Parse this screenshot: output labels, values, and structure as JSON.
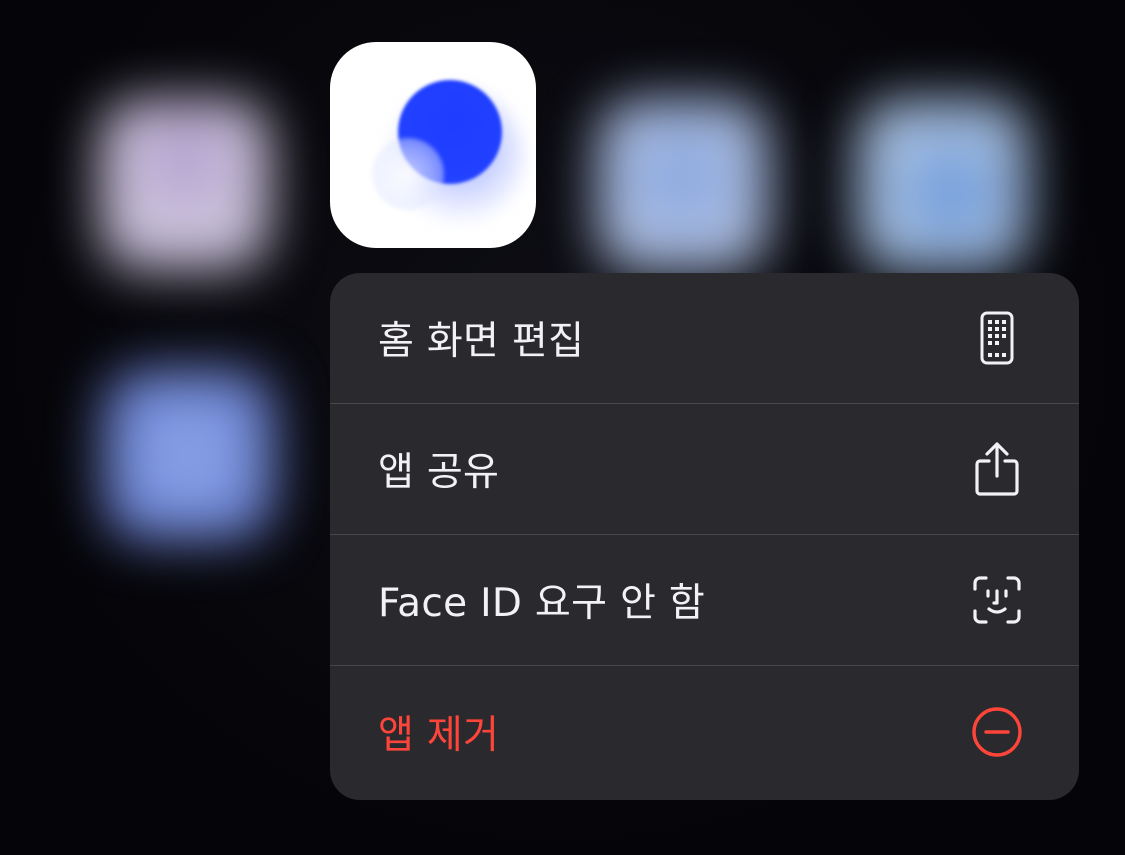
{
  "menu": {
    "items": [
      {
        "label": "홈 화면 편집",
        "icon": "phone-grid-icon"
      },
      {
        "label": "앱 공유",
        "icon": "share-icon"
      },
      {
        "label": "Face ID 요구 안 함",
        "icon": "face-id-icon"
      },
      {
        "label": "앱 제거",
        "icon": "minus-circle-icon"
      }
    ]
  },
  "colors": {
    "menu_background": "#2a2a2e",
    "text": "#f2f2f4",
    "destructive": "#ff453a",
    "app_accent": "#1e3dff"
  }
}
